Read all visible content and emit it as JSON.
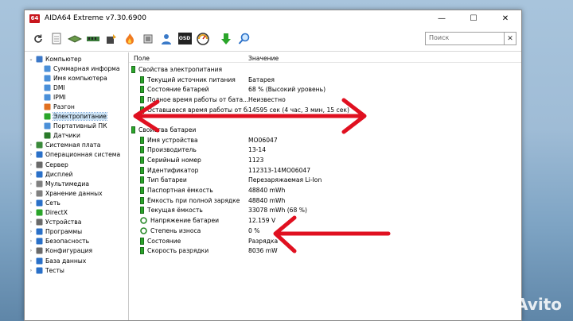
{
  "window": {
    "app_icon": "64",
    "title": "AIDA64 Extreme v7.30.6900",
    "controls": {
      "minimize": "—",
      "maximize": "☐",
      "close": "✕"
    }
  },
  "toolbar": {
    "icons": [
      "refresh-icon",
      "report-icon",
      "motherboard-icon",
      "memory-icon",
      "flame-icon",
      "chip-icon",
      "network-icon",
      "osd-icon",
      "gauge-icon",
      "update-icon",
      "search-icon"
    ],
    "search_placeholder": "Поиск",
    "osd_label": "OSD"
  },
  "tree": [
    {
      "label": "Компьютер",
      "level": 0,
      "exp": "⌄",
      "icon": "computer-icon",
      "color": "#3c78c8"
    },
    {
      "label": "Суммарная информа",
      "level": 1,
      "exp": "",
      "icon": "summary-icon",
      "color": "#4a8fd8"
    },
    {
      "label": "Имя компьютера",
      "level": 1,
      "exp": "",
      "icon": "name-icon",
      "color": "#4a8fd8"
    },
    {
      "label": "DMI",
      "level": 1,
      "exp": "",
      "icon": "dmi-icon",
      "color": "#4a8fd8"
    },
    {
      "label": "IPMI",
      "level": 1,
      "exp": "",
      "icon": "ipmi-icon",
      "color": "#4a8fd8"
    },
    {
      "label": "Разгон",
      "level": 1,
      "exp": "",
      "icon": "flame-icon",
      "color": "#e07020"
    },
    {
      "label": "Электропитание",
      "level": 1,
      "exp": "",
      "icon": "battery-icon",
      "color": "#2aa52a",
      "selected": true
    },
    {
      "label": "Портативный ПК",
      "level": 1,
      "exp": "",
      "icon": "laptop-icon",
      "color": "#4a8fd8"
    },
    {
      "label": "Датчики",
      "level": 1,
      "exp": "",
      "icon": "sensor-icon",
      "color": "#2a7a2a"
    },
    {
      "label": "Системная плата",
      "level": 0,
      "exp": "›",
      "icon": "motherboard-icon",
      "color": "#3a8a3a"
    },
    {
      "label": "Операционная система",
      "level": 0,
      "exp": "›",
      "icon": "os-icon",
      "color": "#2a70c8"
    },
    {
      "label": "Сервер",
      "level": 0,
      "exp": "›",
      "icon": "server-icon",
      "color": "#6a6a6a"
    },
    {
      "label": "Дисплей",
      "level": 0,
      "exp": "›",
      "icon": "display-icon",
      "color": "#2a70c8"
    },
    {
      "label": "Мультимедиа",
      "level": 0,
      "exp": "›",
      "icon": "multimedia-icon",
      "color": "#808080"
    },
    {
      "label": "Хранение данных",
      "level": 0,
      "exp": "›",
      "icon": "storage-icon",
      "color": "#808080"
    },
    {
      "label": "Сеть",
      "level": 0,
      "exp": "›",
      "icon": "network-icon",
      "color": "#2a70c8"
    },
    {
      "label": "DirectX",
      "level": 0,
      "exp": "›",
      "icon": "directx-icon",
      "color": "#2aa52a"
    },
    {
      "label": "Устройства",
      "level": 0,
      "exp": "›",
      "icon": "devices-icon",
      "color": "#6a6a6a"
    },
    {
      "label": "Программы",
      "level": 0,
      "exp": "›",
      "icon": "programs-icon",
      "color": "#2a70c8"
    },
    {
      "label": "Безопасность",
      "level": 0,
      "exp": "›",
      "icon": "security-icon",
      "color": "#2a70c8"
    },
    {
      "label": "Конфигурация",
      "level": 0,
      "exp": "›",
      "icon": "config-icon",
      "color": "#6a6a6a"
    },
    {
      "label": "База данных",
      "level": 0,
      "exp": "›",
      "icon": "database-icon",
      "color": "#2a70c8"
    },
    {
      "label": "Тесты",
      "level": 0,
      "exp": "›",
      "icon": "tests-icon",
      "color": "#2a70c8"
    }
  ],
  "table": {
    "col_field": "Поле",
    "col_value": "Значение",
    "rows": [
      {
        "type": "section",
        "field": "Свойства электропитания"
      },
      {
        "type": "row",
        "field": "Текущий источник питания",
        "value": "Батарея"
      },
      {
        "type": "row",
        "field": "Состояние батарей",
        "value": "68 % (Высокий уровень)"
      },
      {
        "type": "row",
        "field": "Полное время работы от бата...",
        "value": "Неизвестно"
      },
      {
        "type": "row",
        "field": "Оставшееся время работы от бат...",
        "value": "14595 сек (4 час, 3 мин, 15 сек)"
      },
      {
        "type": "blank"
      },
      {
        "type": "section",
        "field": "Свойства батареи"
      },
      {
        "type": "row",
        "field": "Имя устройства",
        "value": "MO06047"
      },
      {
        "type": "row",
        "field": "Производитель",
        "value": "13-14"
      },
      {
        "type": "row",
        "field": "Серийный номер",
        "value": "1123"
      },
      {
        "type": "row",
        "field": "Идентификатор",
        "value": "112313-14MO06047"
      },
      {
        "type": "row",
        "field": "Тип батареи",
        "value": "Перезаряжаемая Li-Ion"
      },
      {
        "type": "row",
        "field": "Паспортная ёмкость",
        "value": "48840 mWh"
      },
      {
        "type": "row",
        "field": "Ёмкость при полной зарядке",
        "value": "48840 mWh"
      },
      {
        "type": "row",
        "field": "Текущая ёмкость",
        "value": "33078 mWh (68 %)"
      },
      {
        "type": "ring",
        "field": "Напряжение батареи",
        "value": "12.159 V"
      },
      {
        "type": "ring",
        "field": "Степень износа",
        "value": "0 %"
      },
      {
        "type": "row",
        "field": "Состояние",
        "value": "Разрядка"
      },
      {
        "type": "row",
        "field": "Скорость разрядки",
        "value": "8036 mW"
      }
    ]
  },
  "watermark": "Avito",
  "colors": {
    "arrow": "#e01020",
    "selection": "#cce4f7",
    "battery": "#2aa52a",
    "window_bg": "#ffffff"
  }
}
